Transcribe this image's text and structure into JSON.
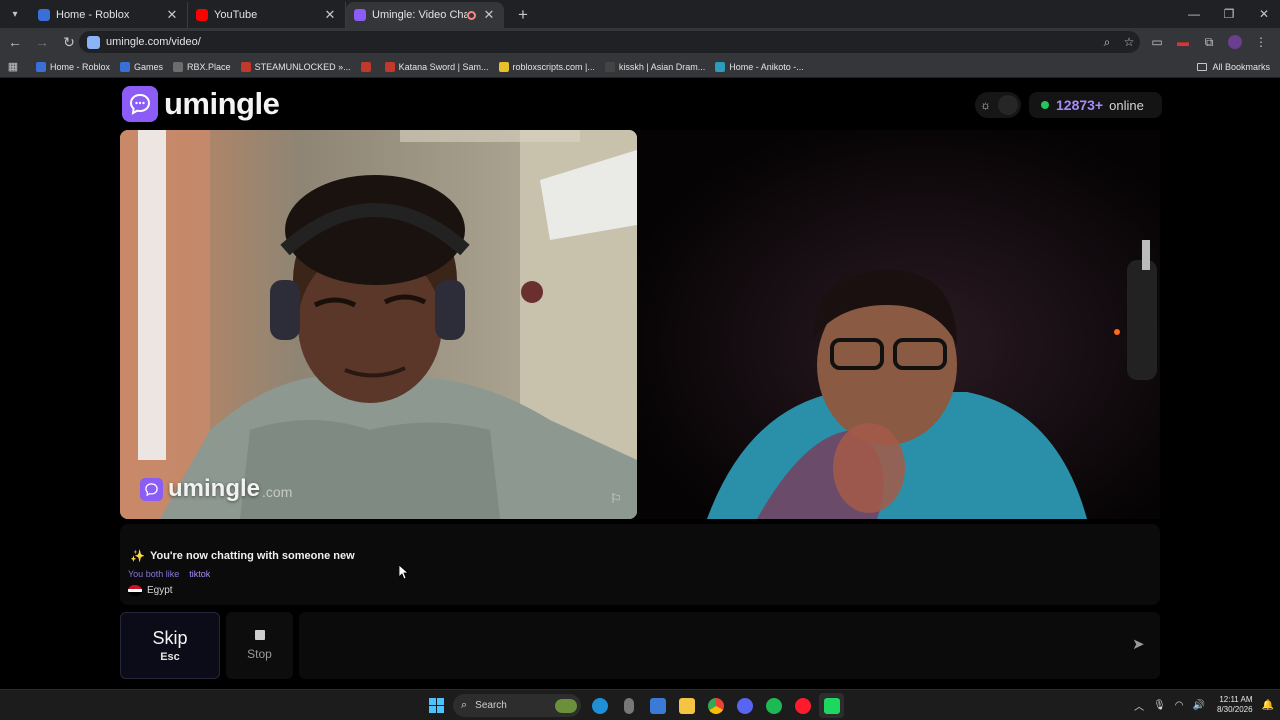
{
  "browser": {
    "tabs": [
      {
        "title": "Home - Roblox",
        "favicon_color": "#3b6fd8",
        "active": false
      },
      {
        "title": "YouTube",
        "favicon_color": "#ff0000",
        "active": false
      },
      {
        "title": "Umingle: Video Chat with S",
        "favicon_color": "#8b5cf6",
        "active": true,
        "recording": true
      }
    ],
    "url": "umingle.com/video/",
    "bookmarks": [
      {
        "label": "Home - Roblox",
        "color": "#3b6fd8"
      },
      {
        "label": "Games",
        "color": "#3b6fd8"
      },
      {
        "label": "RBX.Place",
        "color": "#6d6d6d"
      },
      {
        "label": "STEAMUNLOCKED »...",
        "color": "#c0392b"
      },
      {
        "label": "",
        "color": "#c0392b"
      },
      {
        "label": "Katana Sword | Sam...",
        "color": "#c0392b"
      },
      {
        "label": "robloxscripts.com |...",
        "color": "#e8c02a"
      },
      {
        "label": "kisskh | Asian Dram...",
        "color": "#444444"
      },
      {
        "label": "Home - Anikoto -...",
        "color": "#2a9dbd"
      }
    ],
    "all_bookmarks_label": "All Bookmarks"
  },
  "site": {
    "logo_text": "umingle",
    "online_count": "12873+",
    "online_label": "online",
    "accent": "#8b5cf6",
    "online_dot_color": "#22c55e"
  },
  "video": {
    "watermark_text": "umingle",
    "watermark_domain": ".com"
  },
  "chat": {
    "status": "You're now chatting with someone new",
    "shared_interest_label": "You both like",
    "shared_interest": "tiktok",
    "country": "Egypt"
  },
  "controls": {
    "skip_label": "Skip",
    "skip_key": "Esc",
    "stop_label": "Stop",
    "message_placeholder": ""
  },
  "taskbar": {
    "search_label": "Search",
    "time": "12:11 AM",
    "date": "8/30/2026"
  }
}
